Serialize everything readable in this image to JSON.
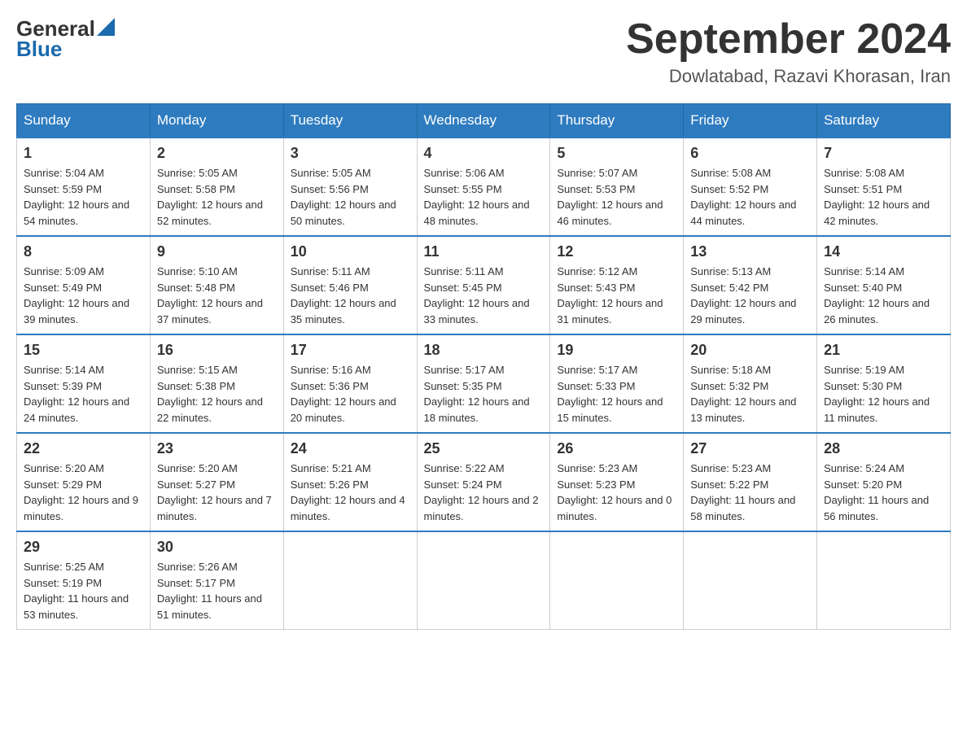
{
  "header": {
    "logo": {
      "general": "General",
      "blue": "Blue"
    },
    "title": "September 2024",
    "location": "Dowlatabad, Razavi Khorasan, Iran"
  },
  "days_of_week": [
    "Sunday",
    "Monday",
    "Tuesday",
    "Wednesday",
    "Thursday",
    "Friday",
    "Saturday"
  ],
  "weeks": [
    [
      {
        "day": "1",
        "sunrise": "5:04 AM",
        "sunset": "5:59 PM",
        "daylight": "12 hours and 54 minutes."
      },
      {
        "day": "2",
        "sunrise": "5:05 AM",
        "sunset": "5:58 PM",
        "daylight": "12 hours and 52 minutes."
      },
      {
        "day": "3",
        "sunrise": "5:05 AM",
        "sunset": "5:56 PM",
        "daylight": "12 hours and 50 minutes."
      },
      {
        "day": "4",
        "sunrise": "5:06 AM",
        "sunset": "5:55 PM",
        "daylight": "12 hours and 48 minutes."
      },
      {
        "day": "5",
        "sunrise": "5:07 AM",
        "sunset": "5:53 PM",
        "daylight": "12 hours and 46 minutes."
      },
      {
        "day": "6",
        "sunrise": "5:08 AM",
        "sunset": "5:52 PM",
        "daylight": "12 hours and 44 minutes."
      },
      {
        "day": "7",
        "sunrise": "5:08 AM",
        "sunset": "5:51 PM",
        "daylight": "12 hours and 42 minutes."
      }
    ],
    [
      {
        "day": "8",
        "sunrise": "5:09 AM",
        "sunset": "5:49 PM",
        "daylight": "12 hours and 39 minutes."
      },
      {
        "day": "9",
        "sunrise": "5:10 AM",
        "sunset": "5:48 PM",
        "daylight": "12 hours and 37 minutes."
      },
      {
        "day": "10",
        "sunrise": "5:11 AM",
        "sunset": "5:46 PM",
        "daylight": "12 hours and 35 minutes."
      },
      {
        "day": "11",
        "sunrise": "5:11 AM",
        "sunset": "5:45 PM",
        "daylight": "12 hours and 33 minutes."
      },
      {
        "day": "12",
        "sunrise": "5:12 AM",
        "sunset": "5:43 PM",
        "daylight": "12 hours and 31 minutes."
      },
      {
        "day": "13",
        "sunrise": "5:13 AM",
        "sunset": "5:42 PM",
        "daylight": "12 hours and 29 minutes."
      },
      {
        "day": "14",
        "sunrise": "5:14 AM",
        "sunset": "5:40 PM",
        "daylight": "12 hours and 26 minutes."
      }
    ],
    [
      {
        "day": "15",
        "sunrise": "5:14 AM",
        "sunset": "5:39 PM",
        "daylight": "12 hours and 24 minutes."
      },
      {
        "day": "16",
        "sunrise": "5:15 AM",
        "sunset": "5:38 PM",
        "daylight": "12 hours and 22 minutes."
      },
      {
        "day": "17",
        "sunrise": "5:16 AM",
        "sunset": "5:36 PM",
        "daylight": "12 hours and 20 minutes."
      },
      {
        "day": "18",
        "sunrise": "5:17 AM",
        "sunset": "5:35 PM",
        "daylight": "12 hours and 18 minutes."
      },
      {
        "day": "19",
        "sunrise": "5:17 AM",
        "sunset": "5:33 PM",
        "daylight": "12 hours and 15 minutes."
      },
      {
        "day": "20",
        "sunrise": "5:18 AM",
        "sunset": "5:32 PM",
        "daylight": "12 hours and 13 minutes."
      },
      {
        "day": "21",
        "sunrise": "5:19 AM",
        "sunset": "5:30 PM",
        "daylight": "12 hours and 11 minutes."
      }
    ],
    [
      {
        "day": "22",
        "sunrise": "5:20 AM",
        "sunset": "5:29 PM",
        "daylight": "12 hours and 9 minutes."
      },
      {
        "day": "23",
        "sunrise": "5:20 AM",
        "sunset": "5:27 PM",
        "daylight": "12 hours and 7 minutes."
      },
      {
        "day": "24",
        "sunrise": "5:21 AM",
        "sunset": "5:26 PM",
        "daylight": "12 hours and 4 minutes."
      },
      {
        "day": "25",
        "sunrise": "5:22 AM",
        "sunset": "5:24 PM",
        "daylight": "12 hours and 2 minutes."
      },
      {
        "day": "26",
        "sunrise": "5:23 AM",
        "sunset": "5:23 PM",
        "daylight": "12 hours and 0 minutes."
      },
      {
        "day": "27",
        "sunrise": "5:23 AM",
        "sunset": "5:22 PM",
        "daylight": "11 hours and 58 minutes."
      },
      {
        "day": "28",
        "sunrise": "5:24 AM",
        "sunset": "5:20 PM",
        "daylight": "11 hours and 56 minutes."
      }
    ],
    [
      {
        "day": "29",
        "sunrise": "5:25 AM",
        "sunset": "5:19 PM",
        "daylight": "11 hours and 53 minutes."
      },
      {
        "day": "30",
        "sunrise": "5:26 AM",
        "sunset": "5:17 PM",
        "daylight": "11 hours and 51 minutes."
      },
      null,
      null,
      null,
      null,
      null
    ]
  ]
}
